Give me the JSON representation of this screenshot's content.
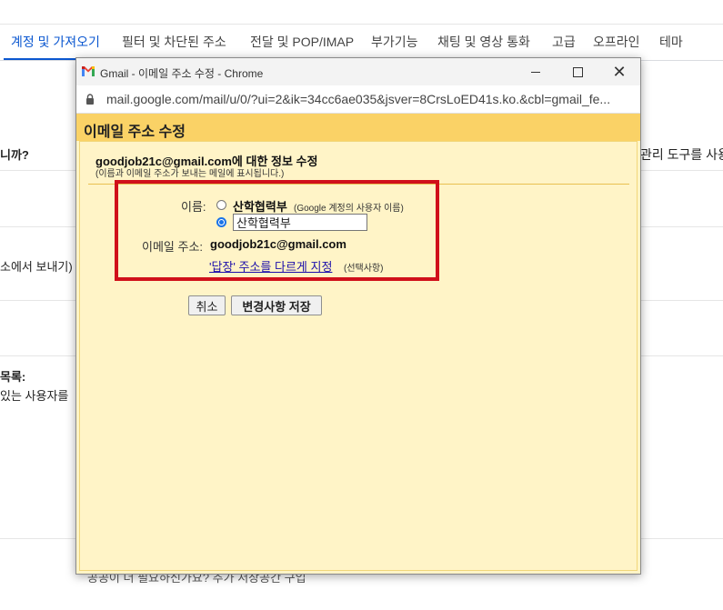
{
  "settings_tabs": [
    {
      "label": "계정 및 가져오기",
      "active": true
    },
    {
      "label": "필터 및 차단된 주소",
      "active": false
    },
    {
      "label": "전달 및 POP/IMAP",
      "active": false
    },
    {
      "label": "부가기능",
      "active": false
    },
    {
      "label": "채팅 및 영상 통화",
      "active": false
    },
    {
      "label": "고급",
      "active": false
    },
    {
      "label": "오프라인",
      "active": false
    },
    {
      "label": "테마",
      "active": false
    }
  ],
  "background": {
    "left_text_1": "니까?",
    "right_text_1": "관리 도구를 사용",
    "left_text_2": "소에서 보내기)",
    "left_text_3": "목록:",
    "left_text_4": "있는 사용자를",
    "bottom_text": "공공이 더 필요하신가요? 추가 저장공간 구입"
  },
  "popup": {
    "window_title": "Gmail - 이메일 주소 수정 - Chrome",
    "url": "mail.google.com/mail/u/0/?ui=2&ik=34cc6ae035&jsver=8CrsLoED41s.ko.&cbl=gmail_fe...",
    "header_title": "이메일 주소 수정",
    "info_title": "goodjob21c@gmail.com에 대한 정보 수정",
    "info_subtitle": "(이름과 이메일 주소가 보내는 메일에 표시됩니다.)",
    "form": {
      "name_label": "이름:",
      "option_google_name": "산학협력부",
      "option_google_hint": "(Google 계정의 사용자 이름)",
      "custom_name_value": "산학협력부",
      "selected_option": "custom",
      "email_label": "이메일 주소:",
      "email_value": "goodjob21c@gmail.com",
      "reply_to_link": "'답장' 주소를 다르게 지정",
      "reply_to_hint": "(선택사항)"
    },
    "buttons": {
      "cancel": "취소",
      "save": "변경사항 저장"
    }
  },
  "colors": {
    "accent": "#0b57d0",
    "dialog_header": "#fad266",
    "dialog_body": "#fff4c7",
    "highlight": "#d0101a"
  }
}
